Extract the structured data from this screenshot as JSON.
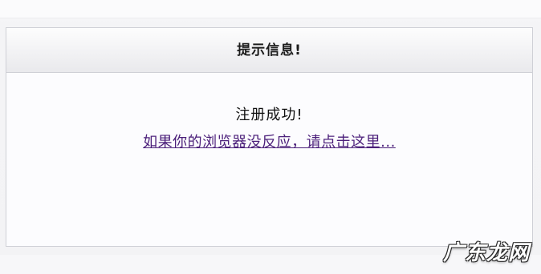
{
  "message": {
    "title": "提示信息!",
    "success_text": "注册成功!",
    "redirect_link": "如果你的浏览器没反应，请点击这里..."
  },
  "watermark": {
    "text": "广东龙网"
  }
}
